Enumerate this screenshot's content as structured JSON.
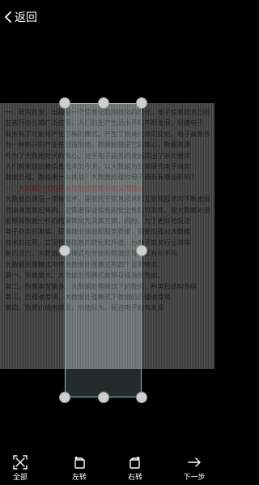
{
  "topbar": {
    "back_label": "返回"
  },
  "toolbar": {
    "select_all": "全部",
    "rotate_left": "左转",
    "rotate_right": "右转",
    "next_step": "下一步"
  },
  "document": {
    "lines": [
      "一、研究背景：当前是一个信息化和网络化的时代，电子信息技术已经",
      "在各行各业被广泛应用，人们的生产生活水平的不断发展，促使电子",
      "商务有了可能并产生了新的模式，产生了颇具代表的变化。电子商务作",
      "为一种新兴的产业在创造价值，数据处理是它的核心，数据资源",
      "作为了大数据时代的核心，对于电子商务的发展提出了新的要求",
      "人们越来越依赖信息技术的今天，以大数据为背景研究电子商务",
      "数据处理，面临着什么挑战？大数据处理对电子商务有哪些影响？",
      "一、大数据时代电子商务数据处理的意义和特点",
      "大数据处理是一项新技术，是依托于信息技术和互联网技术的不断发展",
      "而快速发展起来的，它需要保证信息的安全性和可靠性，使大数据处理",
      "能够将数据分析的结果转化为决策方案，同时，为了更好地促进",
      "电子商务的发展，提高商业效益和服务质量，需要加强对大数据",
      "技术的应用，实现数据信息的转化和升值，为电子商务行业带来",
      "新的活力，大数据处理模式与传统的数据处理模式有所不同",
      "大数据处理模式与传统数据处理模式有四个显著特点：",
      "第一，数据量大，大数据处理模式能够存储海量数据，",
      "第二，数据类型繁多，大数据处理模式下的数据，种类和结构多样",
      "第三，处理速度快，大数据处理模式下数据的处理速度快",
      "第四，数据价值密度低，价值较大，促进电子商务发展"
    ],
    "red_line_index": 7
  }
}
